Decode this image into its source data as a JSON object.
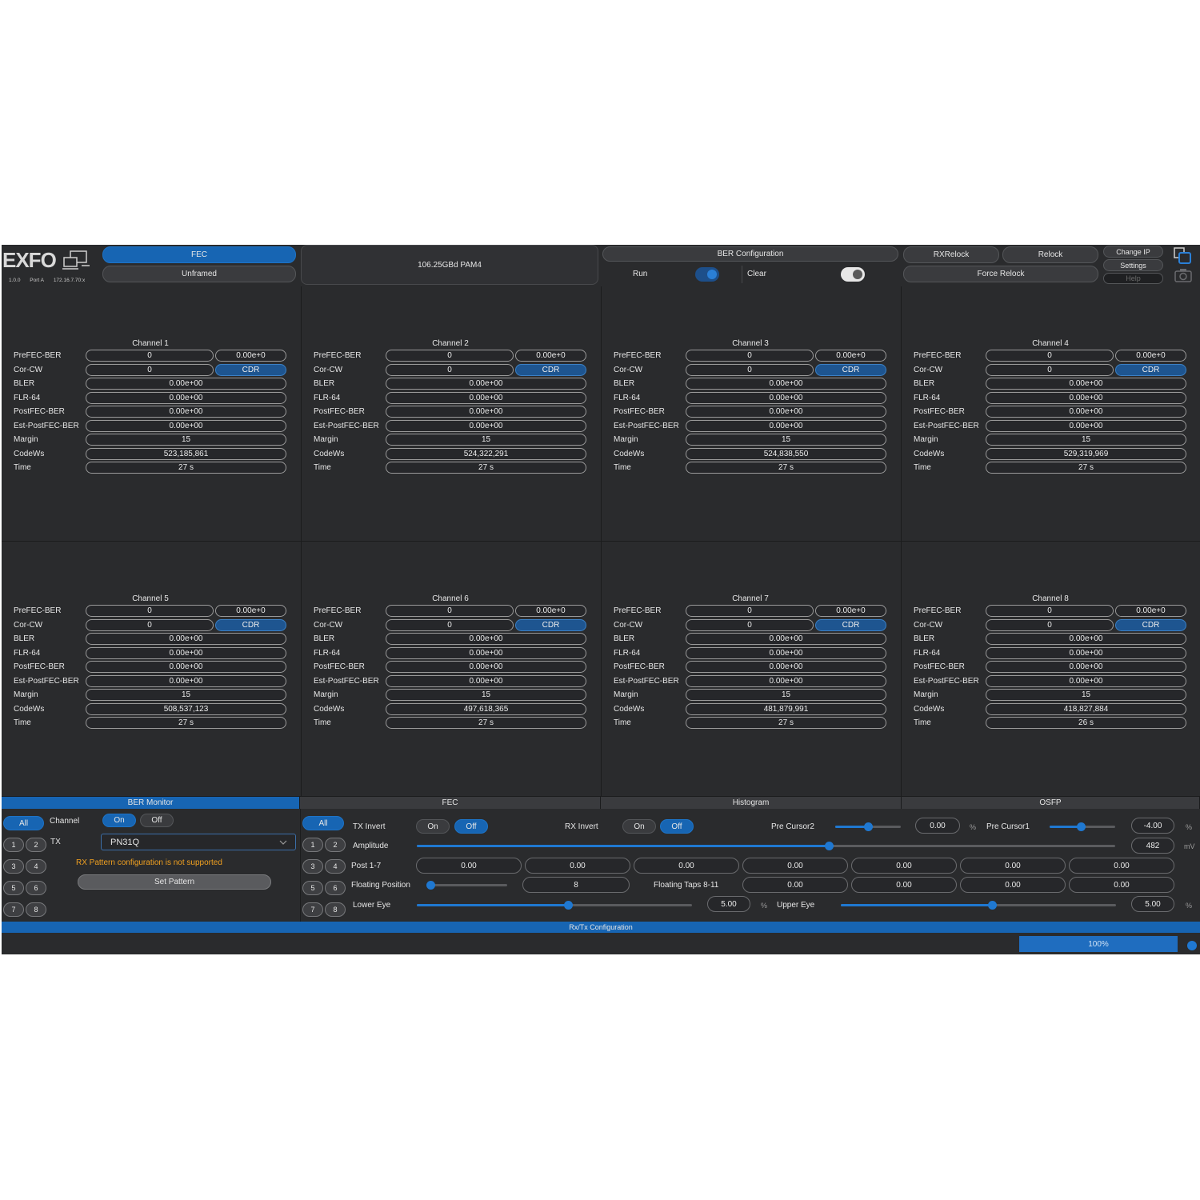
{
  "logo": {
    "text": "EXFO",
    "version": "1.0.0",
    "port": "Port A",
    "ip": "172.16.7.70:x"
  },
  "header": {
    "fec_label": "FEC",
    "framing_label": "Unframed",
    "rate_label": "106.25GBd PAM4",
    "ber_config_label": "BER Configuration",
    "run_label": "Run",
    "run_state": "on",
    "clear_label": "Clear",
    "clear_state": "off",
    "rxrelock_label": "RXRelock",
    "relock_label": "Relock",
    "force_relock_label": "Force Relock",
    "change_ip_label": "Change IP",
    "settings_label": "Settings",
    "help_label": "Help"
  },
  "row_labels": [
    "PreFEC-BER",
    "Cor-CW",
    "BLER",
    "FLR-64",
    "PostFEC-BER",
    "Est-PostFEC-BER",
    "Margin",
    "CodeWs",
    "Time"
  ],
  "channels": [
    {
      "title": "Channel 1",
      "prefec_count": "0",
      "prefec_ber": "0.00e+0",
      "corcw": "0",
      "cdr": "CDR",
      "bler": "0.00e+00",
      "flr64": "0.00e+00",
      "postfec": "0.00e+00",
      "estpostfec": "0.00e+00",
      "margin": "15",
      "codews": "523,185,861",
      "time": "27 s"
    },
    {
      "title": "Channel 2",
      "prefec_count": "0",
      "prefec_ber": "0.00e+0",
      "corcw": "0",
      "cdr": "CDR",
      "bler": "0.00e+00",
      "flr64": "0.00e+00",
      "postfec": "0.00e+00",
      "estpostfec": "0.00e+00",
      "margin": "15",
      "codews": "524,322,291",
      "time": "27 s"
    },
    {
      "title": "Channel 3",
      "prefec_count": "0",
      "prefec_ber": "0.00e+0",
      "corcw": "0",
      "cdr": "CDR",
      "bler": "0.00e+00",
      "flr64": "0.00e+00",
      "postfec": "0.00e+00",
      "estpostfec": "0.00e+00",
      "margin": "15",
      "codews": "524,838,550",
      "time": "27 s"
    },
    {
      "title": "Channel 4",
      "prefec_count": "0",
      "prefec_ber": "0.00e+0",
      "corcw": "0",
      "cdr": "CDR",
      "bler": "0.00e+00",
      "flr64": "0.00e+00",
      "postfec": "0.00e+00",
      "estpostfec": "0.00e+00",
      "margin": "15",
      "codews": "529,319,969",
      "time": "27 s"
    },
    {
      "title": "Channel 5",
      "prefec_count": "0",
      "prefec_ber": "0.00e+0",
      "corcw": "0",
      "cdr": "CDR",
      "bler": "0.00e+00",
      "flr64": "0.00e+00",
      "postfec": "0.00e+00",
      "estpostfec": "0.00e+00",
      "margin": "15",
      "codews": "508,537,123",
      "time": "27 s"
    },
    {
      "title": "Channel 6",
      "prefec_count": "0",
      "prefec_ber": "0.00e+0",
      "corcw": "0",
      "cdr": "CDR",
      "bler": "0.00e+00",
      "flr64": "0.00e+00",
      "postfec": "0.00e+00",
      "estpostfec": "0.00e+00",
      "margin": "15",
      "codews": "497,618,365",
      "time": "27 s"
    },
    {
      "title": "Channel 7",
      "prefec_count": "0",
      "prefec_ber": "0.00e+0",
      "corcw": "0",
      "cdr": "CDR",
      "bler": "0.00e+00",
      "flr64": "0.00e+00",
      "postfec": "0.00e+00",
      "estpostfec": "0.00e+00",
      "margin": "15",
      "codews": "481,879,991",
      "time": "27 s"
    },
    {
      "title": "Channel 8",
      "prefec_count": "0",
      "prefec_ber": "0.00e+0",
      "corcw": "0",
      "cdr": "CDR",
      "bler": "0.00e+00",
      "flr64": "0.00e+00",
      "postfec": "0.00e+00",
      "estpostfec": "0.00e+00",
      "margin": "15",
      "codews": "418,827,884",
      "time": "26 s"
    }
  ],
  "tabs": [
    "BER Monitor",
    "FEC",
    "Histogram",
    "OSFP"
  ],
  "ber_monitor": {
    "all_label": "All",
    "numbers": [
      "1",
      "2",
      "3",
      "4",
      "5",
      "6",
      "7",
      "8"
    ],
    "channel_label": "Channel",
    "on_label": "On",
    "off_label": "Off",
    "tx_label": "TX",
    "tx_pattern": "PN31Q",
    "warning": "RX Pattern configuration is not supported",
    "set_pattern_label": "Set Pattern"
  },
  "fec_panel": {
    "all_label": "All",
    "numbers": [
      "1",
      "2",
      "3",
      "4",
      "5",
      "6",
      "7",
      "8"
    ],
    "tx_invert_label": "TX Invert",
    "rx_invert_label": "RX Invert",
    "on_label": "On",
    "off_label": "Off",
    "amplitude_label": "Amplitude",
    "amplitude_value": "482",
    "amplitude_unit": "mV",
    "amplitude_level": 0.59,
    "pre_cursor2_label": "Pre Cursor2",
    "pre_cursor2_value": "0.00",
    "pre_cursor2_level": 0.5,
    "pre_cursor1_label": "Pre Cursor1",
    "pre_cursor1_value": "-4.00",
    "pre_cursor1_level": 0.48,
    "percent_unit": "%",
    "post_label": "Post 1-7",
    "post_values": [
      "0.00",
      "0.00",
      "0.00",
      "0.00",
      "0.00",
      "0.00",
      "0.00"
    ],
    "floating_position_label": "Floating Position",
    "floating_position_value": "8",
    "floating_position_level": 0.0,
    "floating_taps_label": "Floating Taps 8-11",
    "floating_taps_values": [
      "0.00",
      "0.00",
      "0.00",
      "0.00"
    ],
    "lower_eye_label": "Lower Eye",
    "lower_eye_value": "5.00",
    "lower_eye_level": 0.55,
    "upper_eye_label": "Upper Eye",
    "upper_eye_value": "5.00",
    "upper_eye_level": 0.55
  },
  "status_bar": {
    "label": "Rx/Tx Configuration"
  },
  "footer": {
    "progress": "100%",
    "progress_level": 1.0
  },
  "colors": {
    "accent": "#1765b3",
    "background": "#2a2b2d",
    "cdr": "#1e5590"
  }
}
